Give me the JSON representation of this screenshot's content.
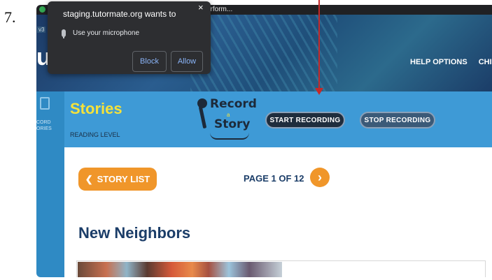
{
  "step_number": "7.",
  "browser": {
    "address_fragment": "erform...",
    "version_tag": "v3",
    "close_glyph": "×"
  },
  "permission_popup": {
    "title": "staging.tutormate.org wants to",
    "request": "Use your microphone",
    "block_label": "Block",
    "allow_label": "Allow"
  },
  "header": {
    "brand_fragment": "ut",
    "nav": [
      "HELP OPTIONS",
      "CHILD IN"
    ]
  },
  "sidebar": {
    "label_lines": [
      "CORD",
      "ORIES"
    ]
  },
  "banner": {
    "title": "Stories",
    "reading_level": "READING LEVEL",
    "logo": {
      "line1": "Record",
      "connector": "a",
      "line2": "Story"
    },
    "start_recording_label": "START RECORDING",
    "stop_recording_label": "STOP RECORDING"
  },
  "pager": {
    "story_list_label": "STORY LIST",
    "back_glyph": "❮",
    "page_indicator": "PAGE 1 OF 12",
    "next_glyph": "›"
  },
  "story": {
    "title": "New Neighbors"
  },
  "colors": {
    "annotation_arrow": "#c62828",
    "banner": "#3e9ad6",
    "accent_orange": "#f0962a",
    "title_yellow": "#f5e23a"
  }
}
